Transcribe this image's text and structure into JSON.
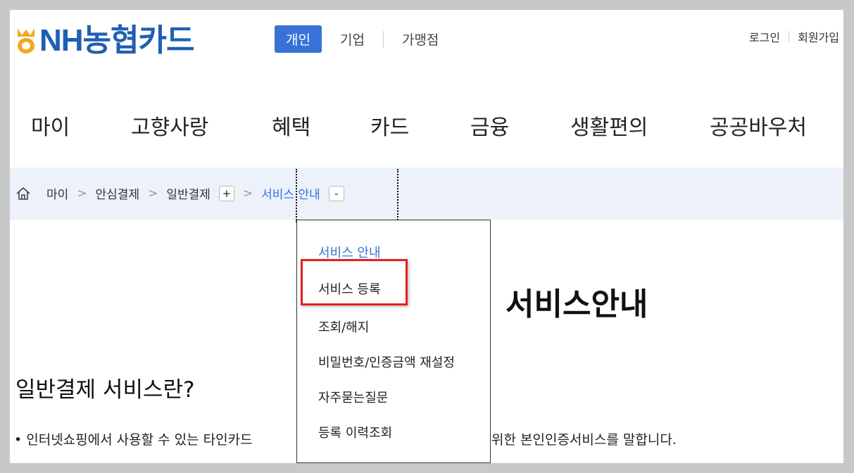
{
  "header": {
    "logo_text": "NH농협카드",
    "segments": [
      "개인",
      "기업",
      "가맹점"
    ],
    "utility": [
      "로그인",
      "회원가입"
    ]
  },
  "gnb": [
    "마이",
    "고향사랑",
    "혜택",
    "카드",
    "금융",
    "생활편의",
    "공공바우처"
  ],
  "breadcrumb": {
    "items": [
      "마이",
      "안심결제",
      "일반결제",
      "서비스 안내"
    ],
    "separator": ">",
    "plus": "+",
    "minus": "-"
  },
  "dropdown": {
    "items": [
      "서비스 안내",
      "서비스 등록",
      "조회/해지",
      "비밀번호/인증금액 재설정",
      "자주묻는질문",
      "등록 이력조회"
    ]
  },
  "main": {
    "title": "서비스안내",
    "section_title": "일반결제 서비스란?",
    "desc_left": "• 인터넷쇼핑에서 사용할 수 있는 타인카드",
    "desc_right": "위한 본인인증서비스를 말합니다."
  },
  "colors": {
    "brand_blue": "#1f5fb3",
    "accent": "#3872d8",
    "logo_gold": "#f2a81d",
    "highlight_red": "#e3201f",
    "crumb_bg": "#edf2fa"
  }
}
